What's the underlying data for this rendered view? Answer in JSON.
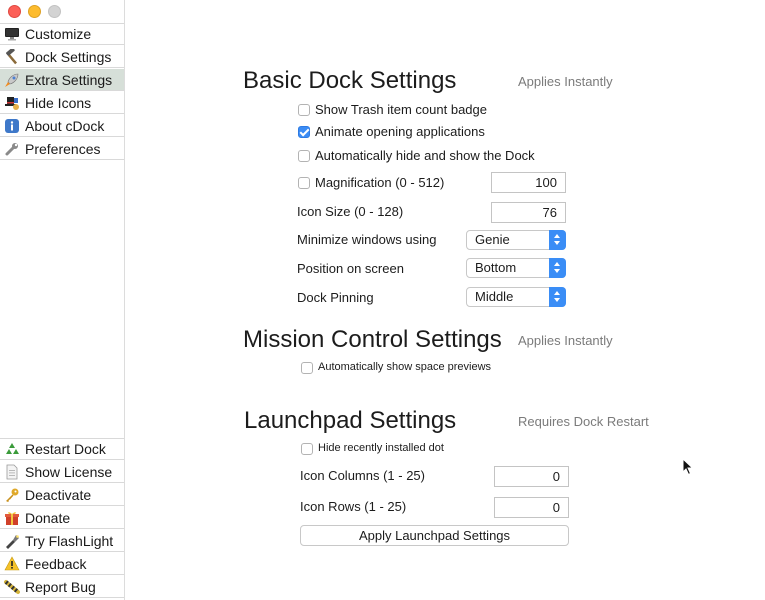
{
  "sidebar": {
    "top_items": [
      {
        "label": "Customize",
        "icon": "monitor-icon"
      },
      {
        "label": "Dock Settings",
        "icon": "hammer-icon"
      },
      {
        "label": "Extra Settings",
        "icon": "rocket-icon",
        "selected": true
      },
      {
        "label": "Hide Icons",
        "icon": "magician-icon"
      },
      {
        "label": "About cDock",
        "icon": "info-icon"
      },
      {
        "label": "Preferences",
        "icon": "wrench-icon"
      }
    ],
    "bottom_items": [
      {
        "label": "Restart Dock",
        "icon": "recycle-icon"
      },
      {
        "label": "Show License",
        "icon": "document-icon"
      },
      {
        "label": "Deactivate",
        "icon": "key-icon"
      },
      {
        "label": "Donate",
        "icon": "gift-icon"
      },
      {
        "label": "Try FlashLight",
        "icon": "flashlight-icon"
      },
      {
        "label": "Feedback",
        "icon": "warning-icon"
      },
      {
        "label": "Report Bug",
        "icon": "bug-icon"
      }
    ]
  },
  "basic": {
    "title": "Basic Dock Settings",
    "note": "Applies Instantly",
    "show_trash": {
      "label": "Show Trash item count badge",
      "checked": false
    },
    "animate": {
      "label": "Animate opening applications",
      "checked": true
    },
    "autohide": {
      "label": "Automatically hide and show the Dock",
      "checked": false
    },
    "magnification": {
      "label": "Magnification (0 - 512)",
      "checked": false,
      "value": "100"
    },
    "icon_size": {
      "label": "Icon Size (0 - 128)",
      "value": "76"
    },
    "minimize": {
      "label": "Minimize windows using",
      "value": "Genie"
    },
    "position": {
      "label": "Position on screen",
      "value": "Bottom"
    },
    "pinning": {
      "label": "Dock Pinning",
      "value": "Middle"
    }
  },
  "mission": {
    "title": "Mission Control Settings",
    "note": "Applies Instantly",
    "space_previews": {
      "label": "Automatically show space previews",
      "checked": false
    }
  },
  "launchpad": {
    "title": "Launchpad Settings",
    "note": "Requires Dock Restart",
    "hide_dot": {
      "label": "Hide recently installed dot",
      "checked": false
    },
    "columns": {
      "label": "Icon Columns (1 - 25)",
      "value": "0"
    },
    "rows": {
      "label": "Icon Rows (1 - 25)",
      "value": "0"
    },
    "apply_label": "Apply Launchpad Settings"
  },
  "colors": {
    "accent": "#3b8cf5",
    "selected_row": "#d6dfd8"
  }
}
